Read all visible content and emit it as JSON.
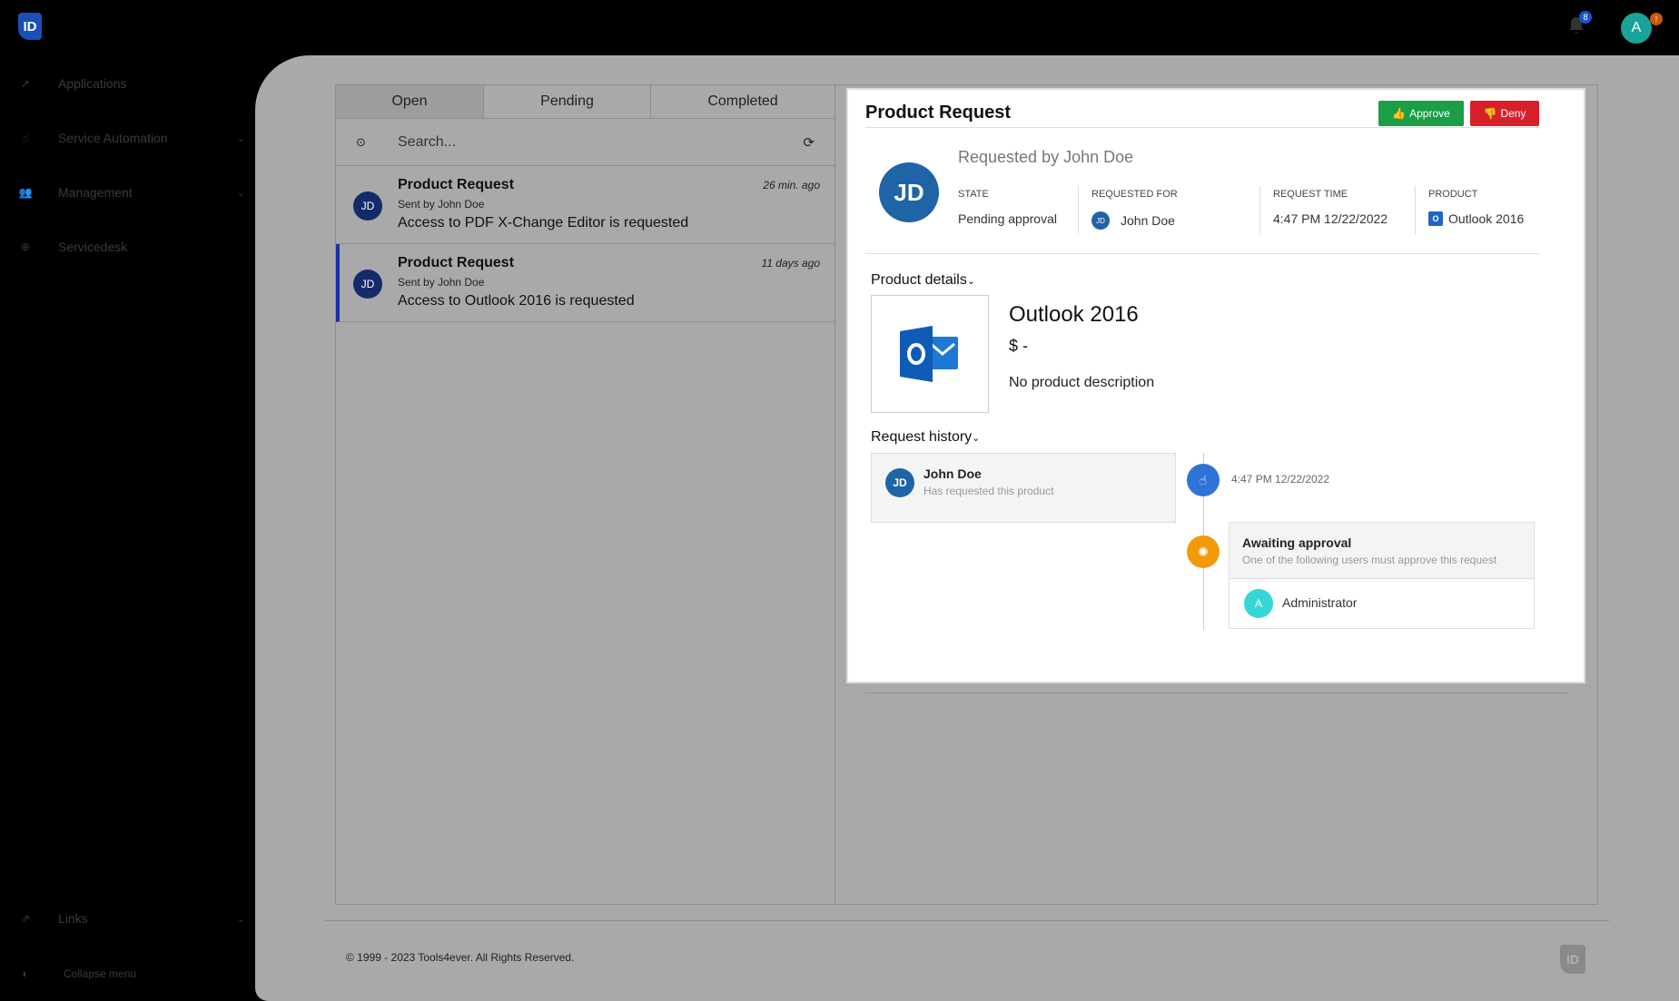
{
  "header": {
    "logo_text": "ID",
    "notification_count": "8",
    "user_initial": "A",
    "user_badge": "!"
  },
  "sidebar": {
    "items": [
      {
        "label": "Applications",
        "icon": "rocket-icon"
      },
      {
        "label": "Service Automation",
        "icon": "hand-pointer-icon"
      },
      {
        "label": "Management",
        "icon": "users-icon"
      },
      {
        "label": "Servicedesk",
        "icon": "lifebuoy-icon"
      }
    ],
    "links_label": "Links",
    "collapse_label": "Collapse menu"
  },
  "tabs": [
    {
      "label": "Open",
      "active": true
    },
    {
      "label": "Pending",
      "active": false
    },
    {
      "label": "Completed",
      "active": false
    }
  ],
  "search": {
    "placeholder": "Search..."
  },
  "requests": [
    {
      "initials": "JD",
      "title": "Product Request",
      "sender": "Sent by John Doe",
      "description": "Access to PDF X-Change Editor is requested",
      "time": "26 min. ago"
    },
    {
      "initials": "JD",
      "title": "Product Request",
      "sender": "Sent by John Doe",
      "description": "Access to Outlook 2016 is requested",
      "time": "11 days ago"
    }
  ],
  "detail": {
    "title": "Product Request",
    "approve_label": "Approve",
    "deny_label": "Deny",
    "requester_initials": "JD",
    "requested_by": "Requested by John Doe",
    "meta": {
      "state_label": "STATE",
      "state_value": "Pending approval",
      "requested_for_label": "REQUESTED FOR",
      "requested_for_initials": "JD",
      "requested_for_value": "John Doe",
      "request_time_label": "REQUEST TIME",
      "request_time_value": "4:47 PM 12/22/2022",
      "product_label": "PRODUCT",
      "product_value": "Outlook 2016"
    },
    "product_details_label": "Product details",
    "product": {
      "name": "Outlook 2016",
      "price": "$ -",
      "description": "No product description"
    },
    "history_label": "Request history",
    "history": {
      "initials": "JD",
      "name": "John Doe",
      "action": "Has requested this product",
      "time": "4:47 PM 12/22/2022",
      "awaiting_title": "Awaiting approval",
      "awaiting_sub": "One of the following users must approve this request",
      "approver_initial": "A",
      "approver_name": "Administrator"
    }
  },
  "footer": {
    "copyright": "© 1999 - 2023 Tools4ever. All Rights Reserved.",
    "logo_text": "ID"
  },
  "colors": {
    "approve": "#1a9e46",
    "deny": "#d81f2c",
    "selected_accent": "#1a2fa8",
    "timeline_blue": "#2f73d8",
    "timeline_orange": "#f39a0b"
  }
}
